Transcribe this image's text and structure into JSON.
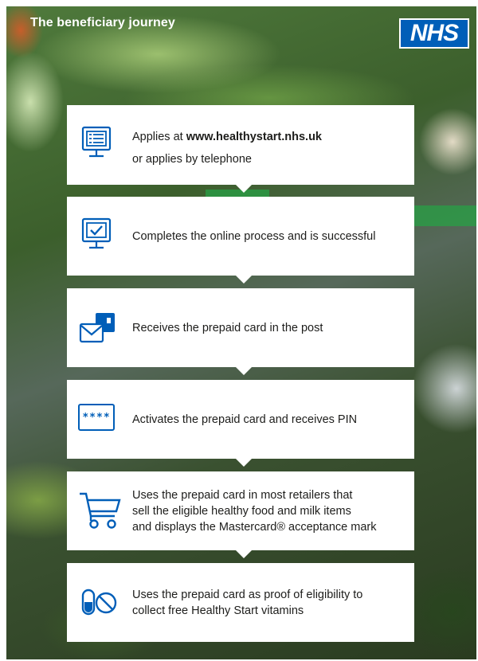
{
  "header": {
    "title": "The beneficiary journey",
    "logo_text": "NHS",
    "logo_color": "#005eb8"
  },
  "steps": [
    {
      "icon": "application-form-icon",
      "lead": "Applies at ",
      "url": "www.healthystart.nhs.uk",
      "second_line": "or applies by telephone"
    },
    {
      "icon": "monitor-check-icon",
      "text": "Completes the online process and is successful"
    },
    {
      "icon": "envelope-card-icon",
      "text": "Receives the prepaid card in the post"
    },
    {
      "icon": "pin-entry-icon",
      "icon_text": "****",
      "text": "Activates the prepaid card and receives PIN"
    },
    {
      "icon": "shopping-cart-icon",
      "lines": [
        "Uses the prepaid card in most retailers that",
        "sell the eligible healthy food and milk items",
        "and displays the Mastercard® acceptance mark"
      ]
    },
    {
      "icon": "vitamins-no-icon",
      "lines": [
        "Uses the prepaid card as proof of eligibility to",
        "collect free Healthy Start vitamins"
      ]
    }
  ],
  "colors": {
    "icon_blue": "#005eb8",
    "card_background": "#ffffff"
  }
}
